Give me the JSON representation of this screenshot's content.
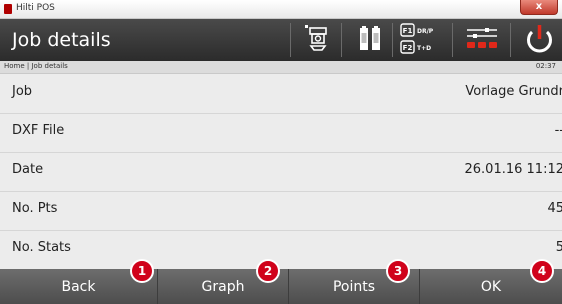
{
  "window": {
    "title": "Hilti POS",
    "close_glyph": "x"
  },
  "header": {
    "title": "Job details",
    "status_icons": [
      "total-station-icon",
      "battery-icon",
      "battery-icon",
      "function-keys-icon",
      "settings-sliders-icon",
      "power-icon"
    ],
    "f1_key": "F1",
    "f1_label": "DR/P",
    "f2_key": "F2",
    "f2_label": "T+D"
  },
  "breadcrumb": {
    "path": "Home | Job details",
    "time": "02:37"
  },
  "details": [
    {
      "label": "Job",
      "value": "Vorlage Grundr"
    },
    {
      "label": "DXF File",
      "value": "--"
    },
    {
      "label": "Date",
      "value": "26.01.16 11:12"
    },
    {
      "label": "No. Pts",
      "value": "45"
    },
    {
      "label": "No. Stats",
      "value": "5"
    }
  ],
  "softkeys": [
    {
      "label": "Back",
      "badge": "1"
    },
    {
      "label": "Graph",
      "badge": "2"
    },
    {
      "label": "Points",
      "badge": "3"
    },
    {
      "label": "OK",
      "badge": "4"
    }
  ],
  "colors": {
    "accent_red": "#d0021b",
    "header_dark": "#2b2b2b",
    "content_bg": "#ececec"
  }
}
